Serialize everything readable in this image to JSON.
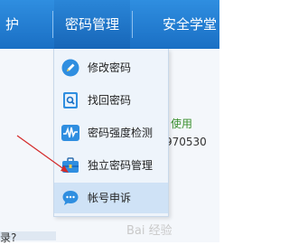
{
  "navbar": {
    "left_tab": "护",
    "active_tab": "密码管理",
    "right_tab": "安全学堂",
    "bg_color": "#2a86d8"
  },
  "background": {
    "green_text": "使用",
    "number_text": "970530",
    "question_text": "录?"
  },
  "menu": {
    "items": [
      {
        "label": "修改密码",
        "icon": "pen-icon"
      },
      {
        "label": "找回密码",
        "icon": "find-password-icon"
      },
      {
        "label": "密码强度检测",
        "icon": "strength-wave-icon"
      },
      {
        "label": "独立密码管理",
        "icon": "briefcase-icon"
      },
      {
        "label": "帐号申诉",
        "icon": "speech-bubble-icon",
        "highlighted": true
      }
    ]
  },
  "watermark": {
    "text": "Bai 经验"
  }
}
